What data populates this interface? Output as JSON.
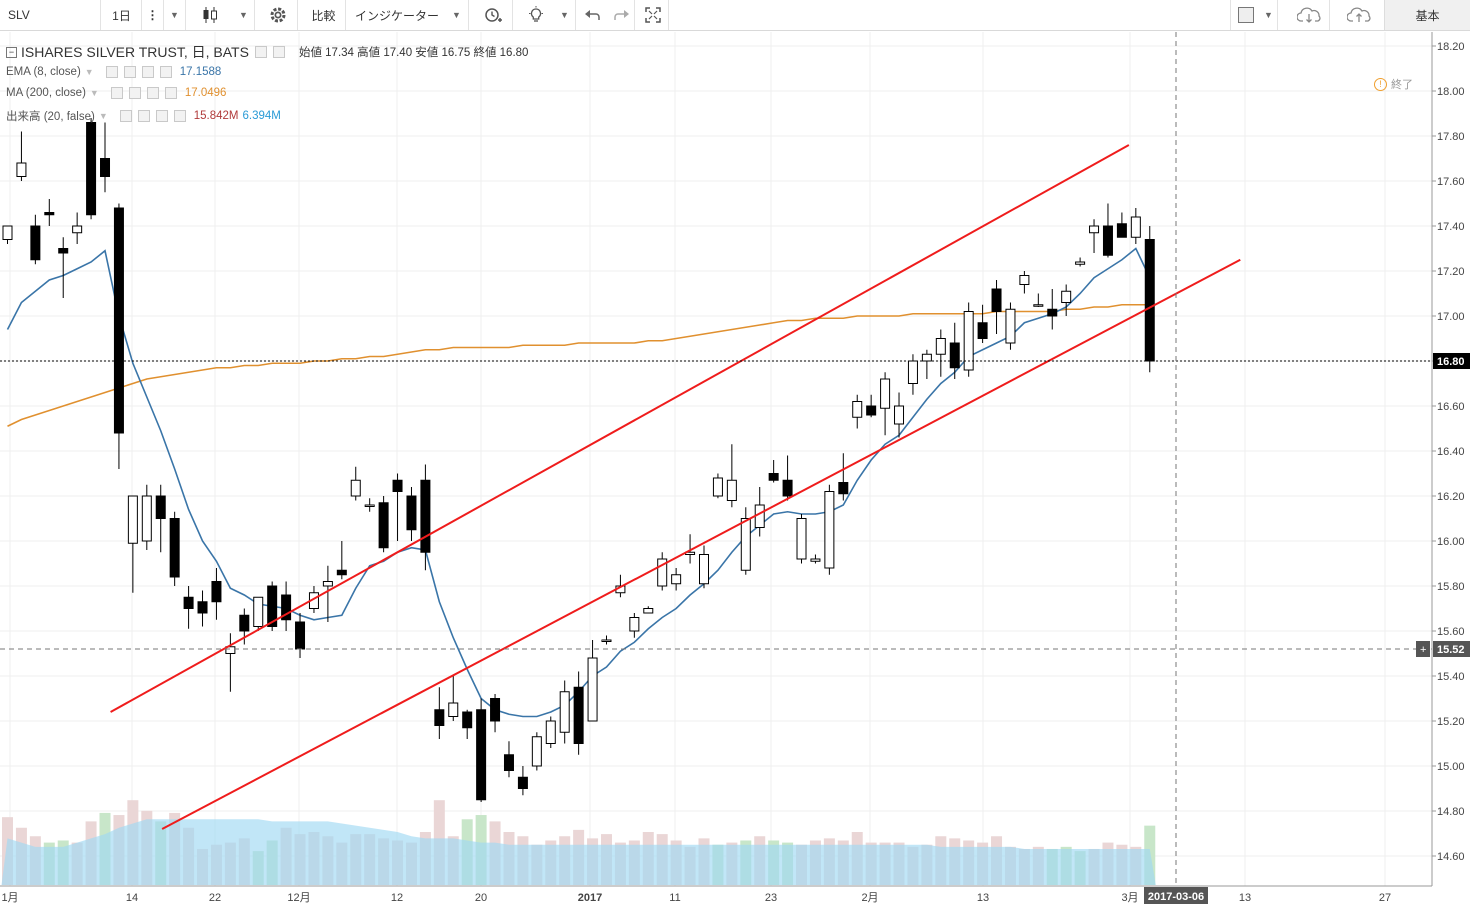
{
  "toolbar": {
    "symbol": "SLV",
    "interval": "1日",
    "compare_label": "比較",
    "indicators_label": "インジケーター",
    "layout_label": "基本"
  },
  "legend": {
    "title": "ISHARES SILVER TRUST, 日, BATS",
    "ohlc": "始値 17.34 高値 17.40 安値 16.75 終値 16.80",
    "ema_label": "EMA (8, close)",
    "ema_value": "17.1588",
    "ma_label": "MA (200, close)",
    "ma_value": "17.0496",
    "vol_label": "出来高 (20, false)",
    "vol_value1": "15.842M",
    "vol_value2": "6.394M"
  },
  "status": {
    "label": "終了"
  },
  "colors": {
    "ema": "#3a75a8",
    "ma": "#e0902f",
    "channel": "#ef1c1c",
    "vol_up": "#c8e6c9",
    "vol_down": "#ead6d6",
    "vol_ma": "#9fd8f3"
  },
  "chart_data": {
    "type": "candlestick",
    "y_ticks": [
      "18.20",
      "18.00",
      "17.80",
      "17.60",
      "17.40",
      "17.20",
      "17.00",
      "16.80",
      "16.60",
      "16.40",
      "16.20",
      "16.00",
      "15.80",
      "15.60",
      "15.40",
      "15.20",
      "15.00",
      "14.80",
      "14.60"
    ],
    "ylim": [
      14.47,
      18.2
    ],
    "x_ticks": [
      "1月",
      "14",
      "22",
      "12月",
      "12",
      "20",
      "2017",
      "11",
      "23",
      "2月",
      "13",
      "3月",
      "13",
      "27"
    ],
    "current_price": "16.80",
    "crosshair_price": "15.52",
    "date_marker": "2017-03-06",
    "candles": [
      [
        17.34,
        17.4,
        17.32,
        17.4
      ],
      [
        17.62,
        17.82,
        17.6,
        17.68
      ],
      [
        17.4,
        17.45,
        17.23,
        17.25
      ],
      [
        17.46,
        17.52,
        17.4,
        17.45
      ],
      [
        17.3,
        17.35,
        17.08,
        17.28
      ],
      [
        17.37,
        17.46,
        17.32,
        17.4
      ],
      [
        17.86,
        17.88,
        17.43,
        17.45
      ],
      [
        17.7,
        17.86,
        17.55,
        17.62
      ],
      [
        17.48,
        17.5,
        16.32,
        16.48
      ],
      [
        15.99,
        16.2,
        15.77,
        16.2
      ],
      [
        16.0,
        16.25,
        15.96,
        16.2
      ],
      [
        16.2,
        16.25,
        15.95,
        16.1
      ],
      [
        16.1,
        16.13,
        15.8,
        15.84
      ],
      [
        15.75,
        15.8,
        15.61,
        15.7
      ],
      [
        15.73,
        15.78,
        15.62,
        15.68
      ],
      [
        15.82,
        15.88,
        15.65,
        15.73
      ],
      [
        15.5,
        15.59,
        15.33,
        15.53
      ],
      [
        15.67,
        15.7,
        15.54,
        15.6
      ],
      [
        15.62,
        15.75,
        15.6,
        15.75
      ],
      [
        15.8,
        15.82,
        15.6,
        15.62
      ],
      [
        15.76,
        15.82,
        15.6,
        15.65
      ],
      [
        15.64,
        15.68,
        15.48,
        15.52
      ],
      [
        15.7,
        15.8,
        15.68,
        15.77
      ],
      [
        15.8,
        15.89,
        15.64,
        15.82
      ],
      [
        15.87,
        16.0,
        15.83,
        15.85
      ],
      [
        16.2,
        16.33,
        16.18,
        16.27
      ],
      [
        16.16,
        16.19,
        16.13,
        16.16
      ],
      [
        16.17,
        16.2,
        15.95,
        15.97
      ],
      [
        16.27,
        16.3,
        16.0,
        16.22
      ],
      [
        16.2,
        16.24,
        16.0,
        16.05
      ],
      [
        16.27,
        16.34,
        15.87,
        15.95
      ],
      [
        15.25,
        15.35,
        15.12,
        15.18
      ],
      [
        15.22,
        15.4,
        15.2,
        15.28
      ],
      [
        15.24,
        15.25,
        15.12,
        15.17
      ],
      [
        15.25,
        15.3,
        14.84,
        14.85
      ],
      [
        15.3,
        15.32,
        15.15,
        15.2
      ],
      [
        15.05,
        15.11,
        14.95,
        14.98
      ],
      [
        14.95,
        15.0,
        14.87,
        14.9
      ],
      [
        15.0,
        15.15,
        14.98,
        15.13
      ],
      [
        15.1,
        15.22,
        15.08,
        15.2
      ],
      [
        15.15,
        15.38,
        15.1,
        15.33
      ],
      [
        15.35,
        15.42,
        15.05,
        15.1
      ],
      [
        15.2,
        15.56,
        15.2,
        15.48
      ],
      [
        15.56,
        15.58,
        15.54,
        15.56
      ],
      [
        15.77,
        15.85,
        15.75,
        15.8
      ],
      [
        15.6,
        15.68,
        15.57,
        15.66
      ],
      [
        15.68,
        15.71,
        15.68,
        15.7
      ],
      [
        15.8,
        15.95,
        15.78,
        15.92
      ],
      [
        15.81,
        15.88,
        15.78,
        15.85
      ],
      [
        15.94,
        16.03,
        15.9,
        15.95
      ],
      [
        15.81,
        15.98,
        15.79,
        15.94
      ],
      [
        16.2,
        16.3,
        16.19,
        16.28
      ],
      [
        16.18,
        16.43,
        16.15,
        16.27
      ],
      [
        15.87,
        16.15,
        15.85,
        16.1
      ],
      [
        16.06,
        16.24,
        16.02,
        16.16
      ],
      [
        16.3,
        16.36,
        16.26,
        16.27
      ],
      [
        16.27,
        16.38,
        16.18,
        16.2
      ],
      [
        15.92,
        16.12,
        15.9,
        16.1
      ],
      [
        15.91,
        15.94,
        15.9,
        15.92
      ],
      [
        15.88,
        16.25,
        15.85,
        16.22
      ],
      [
        16.26,
        16.39,
        16.18,
        16.21
      ],
      [
        16.55,
        16.65,
        16.5,
        16.62
      ],
      [
        16.6,
        16.65,
        16.55,
        16.56
      ],
      [
        16.59,
        16.75,
        16.47,
        16.72
      ],
      [
        16.52,
        16.66,
        16.46,
        16.6
      ],
      [
        16.7,
        16.83,
        16.65,
        16.8
      ],
      [
        16.8,
        16.85,
        16.72,
        16.83
      ],
      [
        16.83,
        16.94,
        16.73,
        16.9
      ],
      [
        16.88,
        16.97,
        16.72,
        16.77
      ],
      [
        16.76,
        17.06,
        16.73,
        17.02
      ],
      [
        16.97,
        17.05,
        16.88,
        16.9
      ],
      [
        17.12,
        17.16,
        16.92,
        17.02
      ],
      [
        16.88,
        17.06,
        16.85,
        17.03
      ],
      [
        17.14,
        17.2,
        17.1,
        17.18
      ],
      [
        17.05,
        17.1,
        17.04,
        17.05
      ],
      [
        17.03,
        17.12,
        16.94,
        17.0
      ],
      [
        17.06,
        17.14,
        17.0,
        17.11
      ],
      [
        17.23,
        17.26,
        17.22,
        17.24
      ],
      [
        17.37,
        17.43,
        17.28,
        17.4
      ],
      [
        17.4,
        17.5,
        17.26,
        17.27
      ],
      [
        17.41,
        17.46,
        17.35,
        17.35
      ],
      [
        17.35,
        17.48,
        17.32,
        17.44
      ],
      [
        17.34,
        17.4,
        16.75,
        16.8
      ]
    ],
    "volume_percent": [
      32,
      27,
      23,
      20,
      21,
      20,
      30,
      34,
      33,
      40,
      35,
      30,
      34,
      27,
      17,
      19,
      20,
      22,
      16,
      21,
      27,
      24,
      25,
      23,
      20,
      24,
      24,
      22,
      21,
      20,
      25,
      40,
      23,
      31,
      33,
      30,
      25,
      23,
      19,
      21,
      23,
      26,
      22,
      24,
      20,
      21,
      25,
      24,
      21,
      18,
      22,
      19,
      20,
      21,
      23,
      21,
      20,
      19,
      21,
      22,
      21,
      25,
      20,
      20,
      20,
      18,
      19,
      23,
      22,
      21,
      20,
      23,
      18,
      17,
      18,
      17,
      18,
      16,
      17,
      20,
      19,
      18,
      28
    ],
    "volume_ma_percent": [
      22,
      20,
      18,
      18,
      18,
      20,
      22,
      24,
      27,
      29,
      31,
      31,
      31,
      31,
      31,
      31,
      31,
      31,
      31,
      30,
      30,
      30,
      30,
      30,
      29,
      28,
      27,
      26,
      25,
      23,
      22,
      22,
      22,
      21,
      20,
      20,
      19,
      19,
      19,
      19,
      19,
      19,
      19,
      19,
      19,
      19,
      19,
      19,
      19,
      19,
      19,
      19,
      19,
      19,
      19,
      19,
      19,
      19,
      19,
      19,
      19,
      19,
      19,
      19,
      19,
      19,
      19,
      18,
      18,
      18,
      18,
      18,
      18,
      17,
      17,
      17,
      17,
      17,
      17,
      17,
      17,
      17,
      17
    ],
    "volume_colors": "ddduuddudddudddddduuddddddddddddduuddddddddddddddddududuudddddddddddddddddduuuddddudd",
    "ema": [
      16.94,
      17.06,
      17.11,
      17.16,
      17.18,
      17.21,
      17.24,
      17.29,
      17.0,
      16.79,
      16.64,
      16.49,
      16.32,
      16.14,
      16.0,
      15.91,
      15.79,
      15.76,
      15.72,
      15.71,
      15.7,
      15.67,
      15.65,
      15.66,
      15.67,
      15.79,
      15.89,
      15.91,
      15.95,
      15.97,
      15.96,
      15.73,
      15.57,
      15.43,
      15.3,
      15.25,
      15.23,
      15.22,
      15.22,
      15.24,
      15.27,
      15.33,
      15.4,
      15.44,
      15.51,
      15.55,
      15.61,
      15.66,
      15.7,
      15.76,
      15.81,
      15.87,
      15.95,
      16.02,
      16.07,
      16.12,
      16.13,
      16.12,
      16.12,
      16.13,
      16.16,
      16.27,
      16.36,
      16.43,
      16.47,
      16.55,
      16.63,
      16.7,
      16.75,
      16.82,
      16.85,
      16.88,
      16.91,
      16.97,
      16.99,
      17.01,
      17.04,
      17.1,
      17.17,
      17.21,
      17.25,
      17.3,
      17.17
    ],
    "ma": [
      16.51,
      16.54,
      16.56,
      16.58,
      16.6,
      16.62,
      16.64,
      16.66,
      16.68,
      16.7,
      16.72,
      16.73,
      16.74,
      16.75,
      16.76,
      16.77,
      16.77,
      16.78,
      16.78,
      16.79,
      16.79,
      16.79,
      16.8,
      16.8,
      16.81,
      16.81,
      16.82,
      16.82,
      16.83,
      16.84,
      16.85,
      16.85,
      16.86,
      16.86,
      16.86,
      16.86,
      16.86,
      16.87,
      16.87,
      16.87,
      16.87,
      16.88,
      16.88,
      16.88,
      16.88,
      16.88,
      16.89,
      16.89,
      16.9,
      16.91,
      16.92,
      16.93,
      16.94,
      16.95,
      16.96,
      16.97,
      16.98,
      16.98,
      16.99,
      16.99,
      16.99,
      17.0,
      17.0,
      17.0,
      17.0,
      17.01,
      17.01,
      17.01,
      17.01,
      17.01,
      17.01,
      17.02,
      17.02,
      17.02,
      17.02,
      17.02,
      17.03,
      17.03,
      17.04,
      17.04,
      17.05,
      17.05,
      17.05
    ],
    "channel_upper": [
      [
        15.24,
        7.4
      ],
      [
        17.76,
        80.5
      ]
    ],
    "channel_lower": [
      [
        14.72,
        11.1
      ],
      [
        17.25,
        88.5
      ]
    ]
  }
}
